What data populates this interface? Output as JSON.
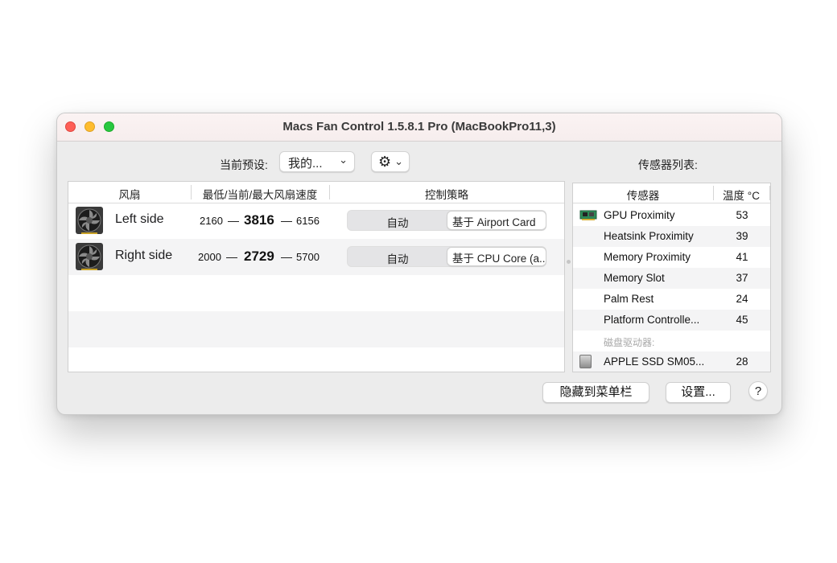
{
  "window": {
    "title": "Macs Fan Control 1.5.8.1 Pro (MacBookPro11,3)"
  },
  "toolbar": {
    "preset_label": "当前预设:",
    "preset_value": "我的...",
    "settings_icon": "gear-icon",
    "chevron_icon": "chevron-down-icon"
  },
  "fans": {
    "headers": {
      "fan": "风扇",
      "speed": "最低/当前/最大风扇速度",
      "control": "控制策略"
    },
    "rows": [
      {
        "name": "Left side",
        "min": "2160",
        "current": "3816",
        "max": "6156",
        "auto_label": "自动",
        "control_label": "基于 Airport Card"
      },
      {
        "name": "Right side",
        "min": "2000",
        "current": "2729",
        "max": "5700",
        "auto_label": "自动",
        "control_label": "基于 CPU Core (a..."
      }
    ],
    "separator": "—"
  },
  "sensors": {
    "title": "传感器列表:",
    "headers": {
      "sensor": "传感器",
      "temp": "温度 °C"
    },
    "rows": [
      {
        "name": "GPU Proximity",
        "value": "53"
      },
      {
        "name": "Heatsink Proximity",
        "value": "39"
      },
      {
        "name": "Memory Proximity",
        "value": "41"
      },
      {
        "name": "Memory Slot",
        "value": "37"
      },
      {
        "name": "Palm Rest",
        "value": "24"
      },
      {
        "name": "Platform Controlle...",
        "value": "45"
      }
    ],
    "group_label": "磁盘驱动器:",
    "disk": {
      "name": "APPLE SSD SM05...",
      "value": "28"
    }
  },
  "buttons": {
    "hide": "隐藏到菜单栏",
    "settings": "设置...",
    "help": "?"
  },
  "colors": {
    "close": "#fe5f57",
    "minimize": "#febc2e",
    "zoom": "#28c840",
    "titlebar": "#f6eded"
  }
}
